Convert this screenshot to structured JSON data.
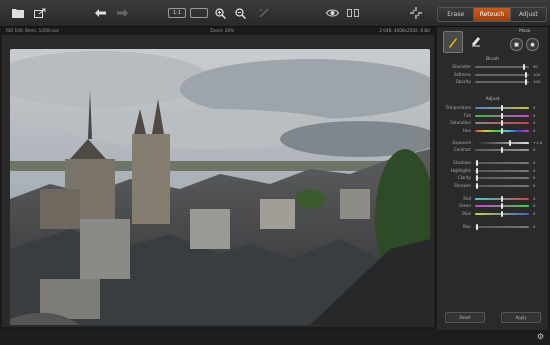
{
  "toolbar": {
    "buttons": [
      {
        "name": "open-folder-icon"
      },
      {
        "name": "export-icon"
      },
      {
        "name": "undo-icon"
      },
      {
        "name": "redo-icon"
      },
      {
        "name": "actual-size-icon"
      },
      {
        "name": "fit-to-screen-icon"
      },
      {
        "name": "zoom-in-icon"
      },
      {
        "name": "zoom-out-icon"
      },
      {
        "name": "straighten-icon"
      },
      {
        "name": "preview-eye-icon"
      },
      {
        "name": "compare-icon"
      },
      {
        "name": "fullscreen-icon"
      }
    ],
    "actual_size_label": "1:1"
  },
  "mode_tabs": [
    {
      "label": "Erase",
      "active": false
    },
    {
      "label": "Retouch",
      "active": true
    },
    {
      "label": "Adjust",
      "active": false
    }
  ],
  "status": {
    "left": "ISO 100, 8mm, 1/200 sec",
    "middle": "Zoom: 20%",
    "right": "2 048, 4608x2592, 8 Bit"
  },
  "panel": {
    "mask_label": "Mask",
    "brush_section": "Brush",
    "brush_sliders": [
      {
        "label": "Diameter",
        "value": "50",
        "pos": 0.92
      },
      {
        "label": "Softness",
        "value": "100",
        "pos": 0.97
      },
      {
        "label": "Opacity",
        "value": "100",
        "pos": 0.97
      }
    ],
    "adjust_section": "Adjust",
    "adjust_sliders": [
      {
        "label": "Temperature",
        "value": "0",
        "pos": 0.5,
        "gradient": "linear-gradient(90deg,#4a7fd0,#d0c040)"
      },
      {
        "label": "Tint",
        "value": "0",
        "pos": 0.5,
        "gradient": "linear-gradient(90deg,#40c040,#d040d0)"
      },
      {
        "label": "Saturation",
        "value": "0",
        "pos": 0.5,
        "gradient": "linear-gradient(90deg,#888,#d04040)"
      },
      {
        "label": "Hue",
        "value": "0",
        "pos": 0.5,
        "gradient": "linear-gradient(90deg,#d04040,#d0d040,#40d040,#40d0d0,#4040d0,#d040d0)"
      },
      {
        "label": "Exposure",
        "value": "+1.0",
        "pos": 0.66,
        "gradient": "linear-gradient(90deg,#222,#ddd)"
      },
      {
        "label": "Contrast",
        "value": "0",
        "pos": 0.5,
        "gradient": "linear-gradient(90deg,#555,#999)"
      },
      {
        "label": "Shadows",
        "value": "0",
        "pos": 0.02,
        "gradient": "linear-gradient(90deg,#555,#777)"
      },
      {
        "label": "Highlights",
        "value": "0",
        "pos": 0.02,
        "gradient": "linear-gradient(90deg,#555,#777)"
      },
      {
        "label": "Clarity",
        "value": "0",
        "pos": 0.02,
        "gradient": "linear-gradient(90deg,#555,#777)"
      },
      {
        "label": "Sharpen",
        "value": "0",
        "pos": 0.02,
        "gradient": "linear-gradient(90deg,#555,#777)"
      },
      {
        "label": "Red",
        "value": "0",
        "pos": 0.5,
        "gradient": "linear-gradient(90deg,#40d0d0,#d04040)"
      },
      {
        "label": "Green",
        "value": "0",
        "pos": 0.5,
        "gradient": "linear-gradient(90deg,#d040d0,#40d040)"
      },
      {
        "label": "Blue",
        "value": "0",
        "pos": 0.5,
        "gradient": "linear-gradient(90deg,#d0d040,#4060d0)"
      },
      {
        "label": "Blur",
        "value": "0",
        "pos": 0.02,
        "gradient": "linear-gradient(90deg,#555,#777)"
      }
    ],
    "reset_label": "Reset",
    "apply_label": "Apply"
  },
  "colors": {
    "accent": "#b84d14",
    "active_tool": "#f0c000"
  }
}
